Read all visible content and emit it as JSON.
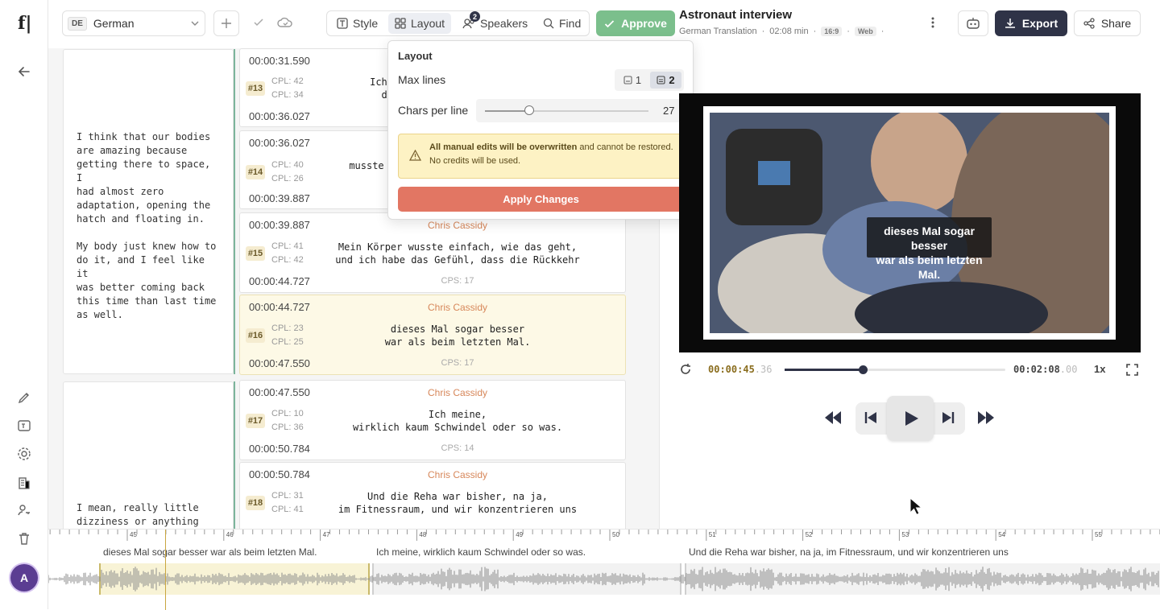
{
  "app": {
    "logo": "f|"
  },
  "user": {
    "initial": "A"
  },
  "language": {
    "code": "DE",
    "name": "German"
  },
  "toolbar": {
    "style_label": "Style",
    "layout_label": "Layout",
    "speakers_label": "Speakers",
    "speakers_badge": "2",
    "find_label": "Find",
    "approve_label": "Approve"
  },
  "project": {
    "title": "Astronaut interview",
    "subtitle": "German Translation",
    "sep": "·",
    "duration": "02:08 min",
    "aspect": "16:9",
    "platform": "Web",
    "export_label": "Export",
    "share_label": "Share"
  },
  "layout_popover": {
    "title": "Layout",
    "max_lines_label": "Max lines",
    "max_lines_options": [
      "1",
      "2"
    ],
    "max_lines_selected": "2",
    "chars_label": "Chars per line",
    "chars_value": "27",
    "chars_slider_fraction": 0.27,
    "warning_bold": "All manual edits will be overwritten",
    "warning_rest": " and cannot be restored. No credits will be used.",
    "apply_label": "Apply Changes"
  },
  "source_blocks": [
    {
      "text": "I think that our bodies\nare amazing because\ngetting there to space, I\nhad almost zero\nadaptation, opening the\nhatch and floating in.\n\nMy body just knew how to\ndo it, and I feel like it\nwas better coming back\nthis time than last time\nas well."
    },
    {
      "text": "I mean, really little\ndizziness or anything like"
    }
  ],
  "segments": [
    {
      "num": "#13",
      "start": "00:00:31.590",
      "end": "00:00:36.027",
      "speaker": "",
      "cpl1": "CPL: 42",
      "cpl2": "CPL: 34",
      "line1": "Ich find",
      "line2": "denn",
      "cps": ""
    },
    {
      "num": "#14",
      "start": "00:00:36.027",
      "end": "00:00:39.887",
      "speaker": "",
      "cpl1": "CPL: 40",
      "cpl2": "CPL: 26",
      "line1": "musste",
      "line2": "",
      "cps": ""
    },
    {
      "num": "#15",
      "start": "00:00:39.887",
      "end": "00:00:44.727",
      "speaker": "Chris Cassidy",
      "cpl1": "CPL: 41",
      "cpl2": "CPL: 42",
      "line1": "Mein Körper wusste einfach, wie das geht,",
      "line2": "und ich habe das Gefühl, dass die Rückkehr",
      "cps": "CPS: 17"
    },
    {
      "num": "#16",
      "start": "00:00:44.727",
      "end": "00:00:47.550",
      "speaker": "Chris Cassidy",
      "cpl1": "CPL: 23",
      "cpl2": "CPL: 25",
      "line1": "dieses Mal sogar besser",
      "line2": "war als beim letzten Mal.",
      "cps": "CPS: 17"
    },
    {
      "num": "#17",
      "start": "00:00:47.550",
      "end": "00:00:50.784",
      "speaker": "Chris Cassidy",
      "cpl1": "CPL: 10",
      "cpl2": "CPL: 36",
      "line1": "Ich meine,",
      "line2": "wirklich kaum Schwindel oder so was.",
      "cps": "CPS: 14"
    },
    {
      "num": "#18",
      "start": "00:00:50.784",
      "end": "",
      "speaker": "Chris Cassidy",
      "cpl1": "CPL: 31",
      "cpl2": "CPL: 41",
      "line1": "Und die Reha war bisher, na ja,",
      "line2": "im Fitnessraum, und wir konzentrieren uns",
      "cps": ""
    }
  ],
  "player": {
    "subtitle_line1": "dieses Mal sogar besser",
    "subtitle_line2": "war als beim letzten Mal.",
    "current_main": "00:00:45",
    "current_frac": ".36",
    "total_main": "00:02:08",
    "total_frac": ".00",
    "speed": "1x",
    "progress_fraction": 0.355
  },
  "timeline": {
    "ticks": [
      "45",
      "46",
      "47",
      "48",
      "49",
      "50",
      "51",
      "52",
      "53",
      "54",
      "55"
    ],
    "captions": [
      "dieses Mal sogar besser war als beim letzten Mal.",
      "Ich meine, wirklich kaum Schwindel oder so was.",
      "Und die Reha war bisher, na ja, im Fitnessraum, und wir konzentrieren uns"
    ]
  },
  "colors": {
    "accent_dark": "#2f3347",
    "approve": "#7bbf8c",
    "apply": "#e27663",
    "speaker": "#d7875a",
    "active_row": "#fdf9e6",
    "avatar": "#5b3d92"
  }
}
